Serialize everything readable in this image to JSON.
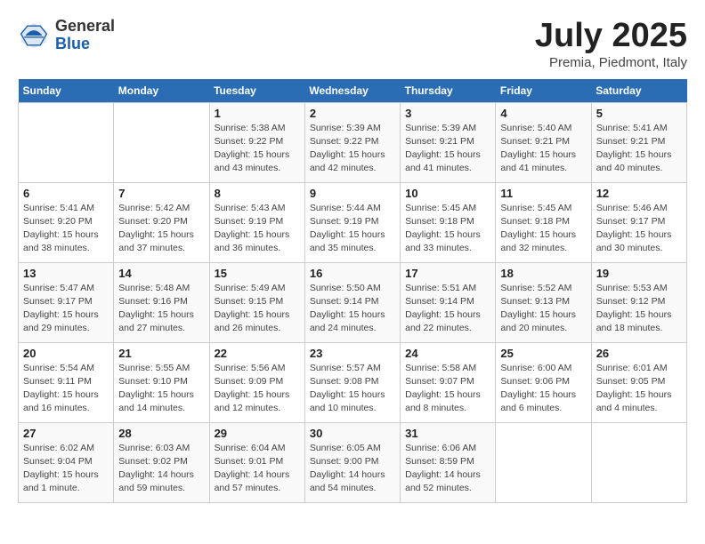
{
  "header": {
    "logo_general": "General",
    "logo_blue": "Blue",
    "month": "July 2025",
    "location": "Premia, Piedmont, Italy"
  },
  "weekdays": [
    "Sunday",
    "Monday",
    "Tuesday",
    "Wednesday",
    "Thursday",
    "Friday",
    "Saturday"
  ],
  "weeks": [
    [
      {
        "day": "",
        "info": ""
      },
      {
        "day": "",
        "info": ""
      },
      {
        "day": "1",
        "info": "Sunrise: 5:38 AM\nSunset: 9:22 PM\nDaylight: 15 hours and 43 minutes."
      },
      {
        "day": "2",
        "info": "Sunrise: 5:39 AM\nSunset: 9:22 PM\nDaylight: 15 hours and 42 minutes."
      },
      {
        "day": "3",
        "info": "Sunrise: 5:39 AM\nSunset: 9:21 PM\nDaylight: 15 hours and 41 minutes."
      },
      {
        "day": "4",
        "info": "Sunrise: 5:40 AM\nSunset: 9:21 PM\nDaylight: 15 hours and 41 minutes."
      },
      {
        "day": "5",
        "info": "Sunrise: 5:41 AM\nSunset: 9:21 PM\nDaylight: 15 hours and 40 minutes."
      }
    ],
    [
      {
        "day": "6",
        "info": "Sunrise: 5:41 AM\nSunset: 9:20 PM\nDaylight: 15 hours and 38 minutes."
      },
      {
        "day": "7",
        "info": "Sunrise: 5:42 AM\nSunset: 9:20 PM\nDaylight: 15 hours and 37 minutes."
      },
      {
        "day": "8",
        "info": "Sunrise: 5:43 AM\nSunset: 9:19 PM\nDaylight: 15 hours and 36 minutes."
      },
      {
        "day": "9",
        "info": "Sunrise: 5:44 AM\nSunset: 9:19 PM\nDaylight: 15 hours and 35 minutes."
      },
      {
        "day": "10",
        "info": "Sunrise: 5:45 AM\nSunset: 9:18 PM\nDaylight: 15 hours and 33 minutes."
      },
      {
        "day": "11",
        "info": "Sunrise: 5:45 AM\nSunset: 9:18 PM\nDaylight: 15 hours and 32 minutes."
      },
      {
        "day": "12",
        "info": "Sunrise: 5:46 AM\nSunset: 9:17 PM\nDaylight: 15 hours and 30 minutes."
      }
    ],
    [
      {
        "day": "13",
        "info": "Sunrise: 5:47 AM\nSunset: 9:17 PM\nDaylight: 15 hours and 29 minutes."
      },
      {
        "day": "14",
        "info": "Sunrise: 5:48 AM\nSunset: 9:16 PM\nDaylight: 15 hours and 27 minutes."
      },
      {
        "day": "15",
        "info": "Sunrise: 5:49 AM\nSunset: 9:15 PM\nDaylight: 15 hours and 26 minutes."
      },
      {
        "day": "16",
        "info": "Sunrise: 5:50 AM\nSunset: 9:14 PM\nDaylight: 15 hours and 24 minutes."
      },
      {
        "day": "17",
        "info": "Sunrise: 5:51 AM\nSunset: 9:14 PM\nDaylight: 15 hours and 22 minutes."
      },
      {
        "day": "18",
        "info": "Sunrise: 5:52 AM\nSunset: 9:13 PM\nDaylight: 15 hours and 20 minutes."
      },
      {
        "day": "19",
        "info": "Sunrise: 5:53 AM\nSunset: 9:12 PM\nDaylight: 15 hours and 18 minutes."
      }
    ],
    [
      {
        "day": "20",
        "info": "Sunrise: 5:54 AM\nSunset: 9:11 PM\nDaylight: 15 hours and 16 minutes."
      },
      {
        "day": "21",
        "info": "Sunrise: 5:55 AM\nSunset: 9:10 PM\nDaylight: 15 hours and 14 minutes."
      },
      {
        "day": "22",
        "info": "Sunrise: 5:56 AM\nSunset: 9:09 PM\nDaylight: 15 hours and 12 minutes."
      },
      {
        "day": "23",
        "info": "Sunrise: 5:57 AM\nSunset: 9:08 PM\nDaylight: 15 hours and 10 minutes."
      },
      {
        "day": "24",
        "info": "Sunrise: 5:58 AM\nSunset: 9:07 PM\nDaylight: 15 hours and 8 minutes."
      },
      {
        "day": "25",
        "info": "Sunrise: 6:00 AM\nSunset: 9:06 PM\nDaylight: 15 hours and 6 minutes."
      },
      {
        "day": "26",
        "info": "Sunrise: 6:01 AM\nSunset: 9:05 PM\nDaylight: 15 hours and 4 minutes."
      }
    ],
    [
      {
        "day": "27",
        "info": "Sunrise: 6:02 AM\nSunset: 9:04 PM\nDaylight: 15 hours and 1 minute."
      },
      {
        "day": "28",
        "info": "Sunrise: 6:03 AM\nSunset: 9:02 PM\nDaylight: 14 hours and 59 minutes."
      },
      {
        "day": "29",
        "info": "Sunrise: 6:04 AM\nSunset: 9:01 PM\nDaylight: 14 hours and 57 minutes."
      },
      {
        "day": "30",
        "info": "Sunrise: 6:05 AM\nSunset: 9:00 PM\nDaylight: 14 hours and 54 minutes."
      },
      {
        "day": "31",
        "info": "Sunrise: 6:06 AM\nSunset: 8:59 PM\nDaylight: 14 hours and 52 minutes."
      },
      {
        "day": "",
        "info": ""
      },
      {
        "day": "",
        "info": ""
      }
    ]
  ]
}
